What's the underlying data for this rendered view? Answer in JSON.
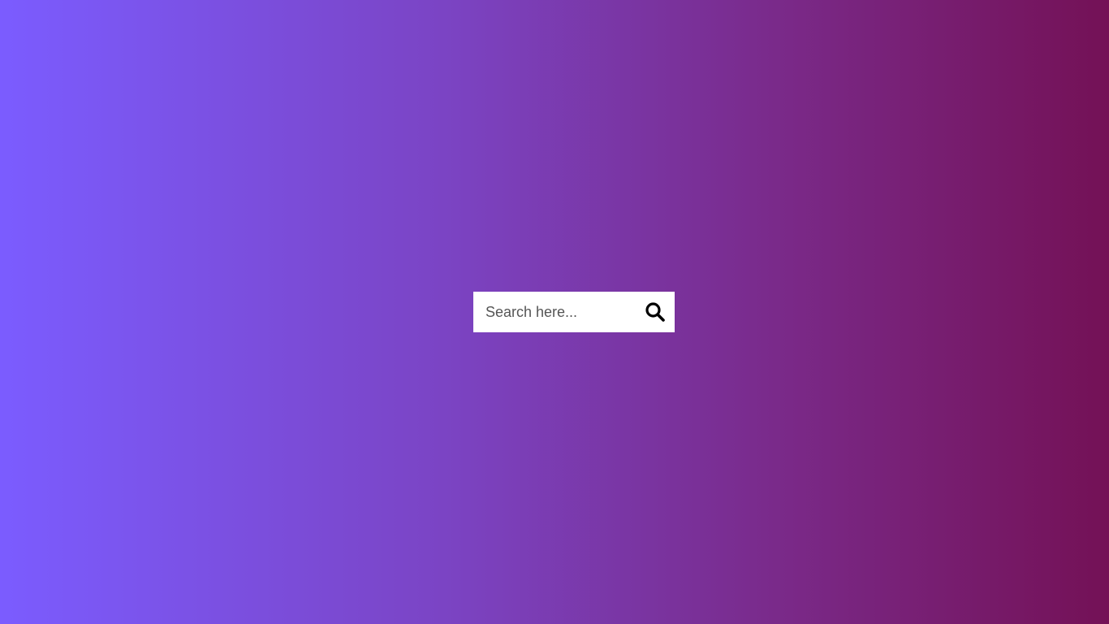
{
  "colors": {
    "gradient_start": "#7b5cff",
    "gradient_end": "#741156",
    "search_box_bg": "#ffffff",
    "icon_color": "#000000"
  },
  "search": {
    "placeholder": "Search here...",
    "value": "",
    "button_icon": "search-icon"
  }
}
